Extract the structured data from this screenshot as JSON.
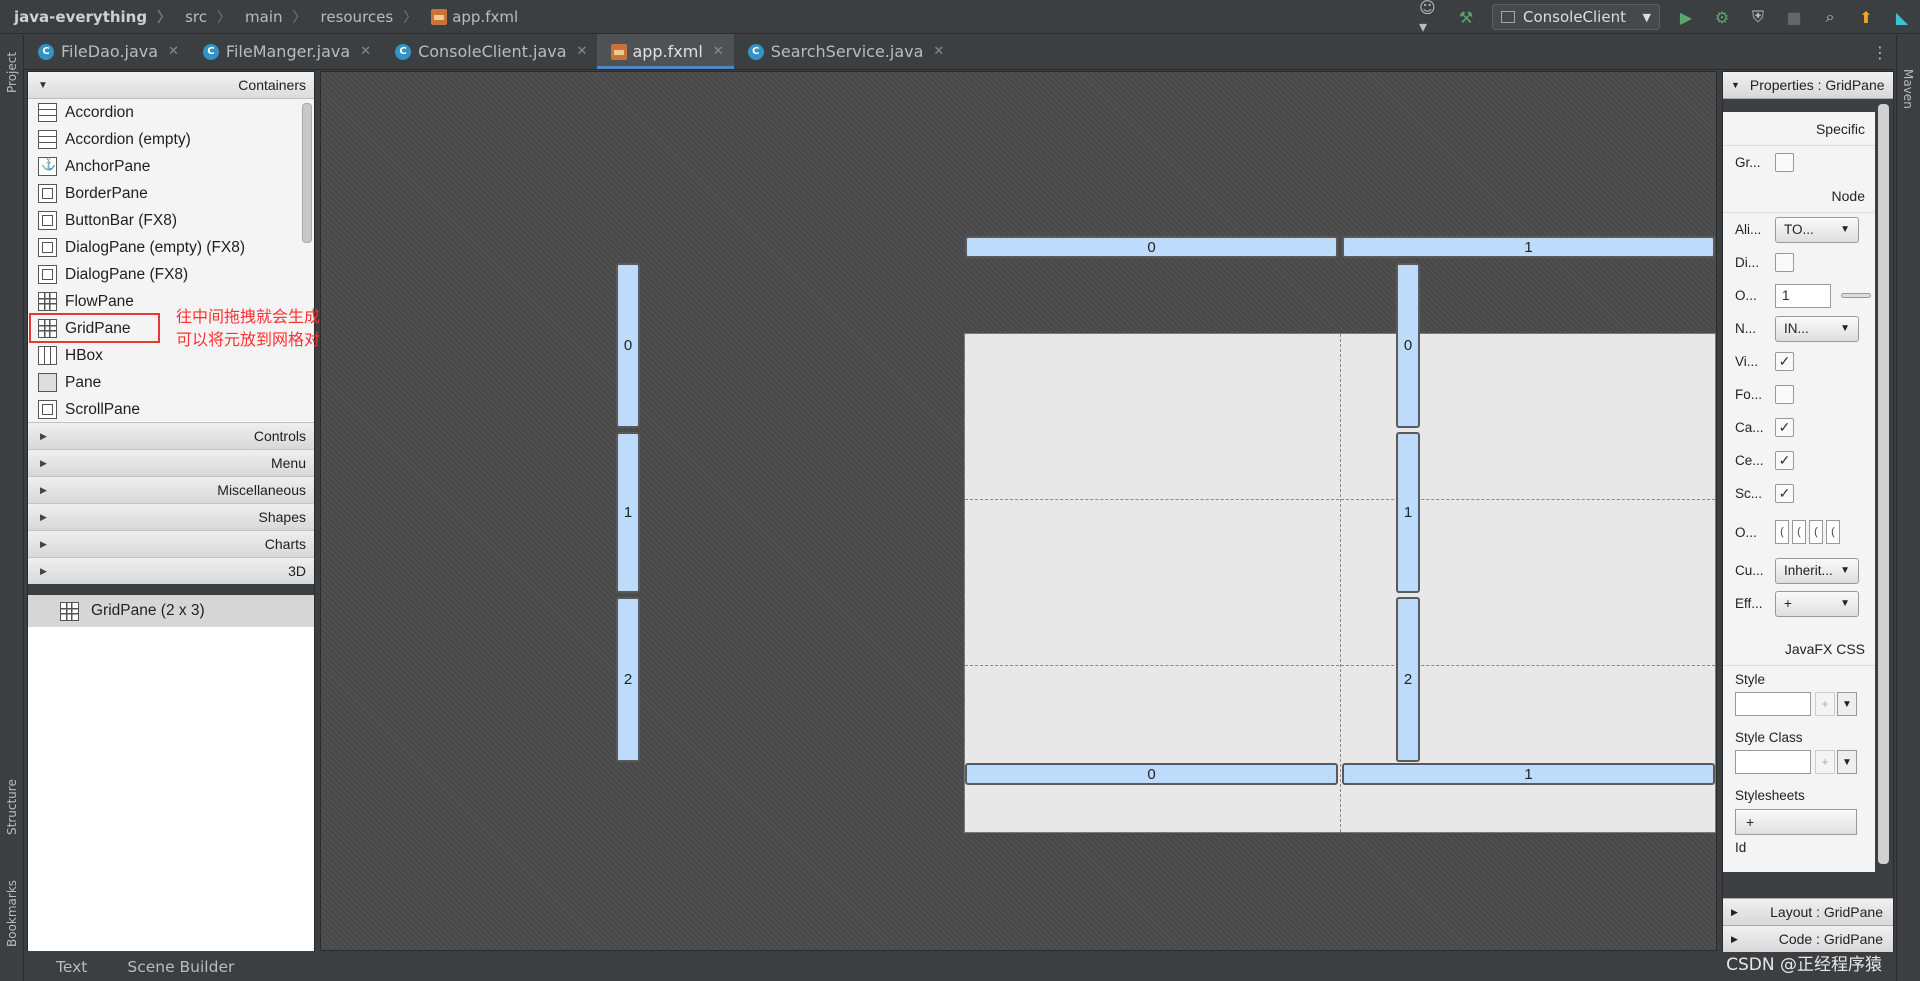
{
  "breadcrumbs": [
    "java-everything",
    "src",
    "main",
    "resources",
    "app.fxml"
  ],
  "toolbar": {
    "run_config": "ConsoleClient"
  },
  "tabs": [
    {
      "label": "FileDao.java",
      "active": false
    },
    {
      "label": "FileManger.java",
      "active": false
    },
    {
      "label": "ConsoleClient.java",
      "active": false
    },
    {
      "label": "app.fxml",
      "active": true
    },
    {
      "label": "SearchService.java",
      "active": false
    }
  ],
  "stripes": {
    "project": "Project",
    "structure": "Structure",
    "bookmarks": "Bookmarks",
    "maven": "Maven"
  },
  "library": {
    "header": "Containers",
    "items": [
      "Accordion",
      "Accordion  (empty)",
      "AnchorPane",
      "BorderPane",
      "ButtonBar  (FX8)",
      "DialogPane (empty)  (FX8)",
      "DialogPane  (FX8)",
      "FlowPane",
      "GridPane",
      "HBox",
      "Pane",
      "ScrollPane"
    ],
    "sections": [
      "Controls",
      "Menu",
      "Miscellaneous",
      "Shapes",
      "Charts",
      "3D"
    ],
    "hierarchy_item": "GridPane (2 x 3)"
  },
  "annotation": {
    "line1": "往中间拖拽就会生成如图所示的网格",
    "line2": "可以将元放到网格对应的位置",
    "color": "#ff3030"
  },
  "grid": {
    "columns": [
      "0",
      "1"
    ],
    "rows": [
      "0",
      "1",
      "2"
    ],
    "header_color": "#bddcfb"
  },
  "properties": {
    "header": "Properties : GridPane",
    "specific": "Specific",
    "gr_label": "Gr...",
    "node": "Node",
    "alignment_label": "Ali...",
    "alignment_value": "TO...",
    "disable_label": "Di...",
    "opacity_label": "O...",
    "opacity_value": "1",
    "node_orient_label": "N...",
    "node_orient_value": "IN...",
    "visible_label": "Vi...",
    "focus_label": "Fo...",
    "cache_label": "Ca...",
    "center_label": "Ce...",
    "scale_label": "Sc...",
    "opaque_label": "O...",
    "cursor_label": "Cu...",
    "cursor_value": "Inherit...",
    "effect_label": "Eff...",
    "effect_value": "+",
    "javafx_css": "JavaFX CSS",
    "style": "Style",
    "style_class": "Style Class",
    "stylesheets": "Stylesheets",
    "stylesheets_button": "+",
    "id_label": "Id",
    "layout_footer": "Layout : GridPane",
    "code_footer": "Code : GridPane"
  },
  "bottom_tabs": [
    "Text",
    "Scene Builder"
  ],
  "watermark": "CSDN @正经程序猿"
}
